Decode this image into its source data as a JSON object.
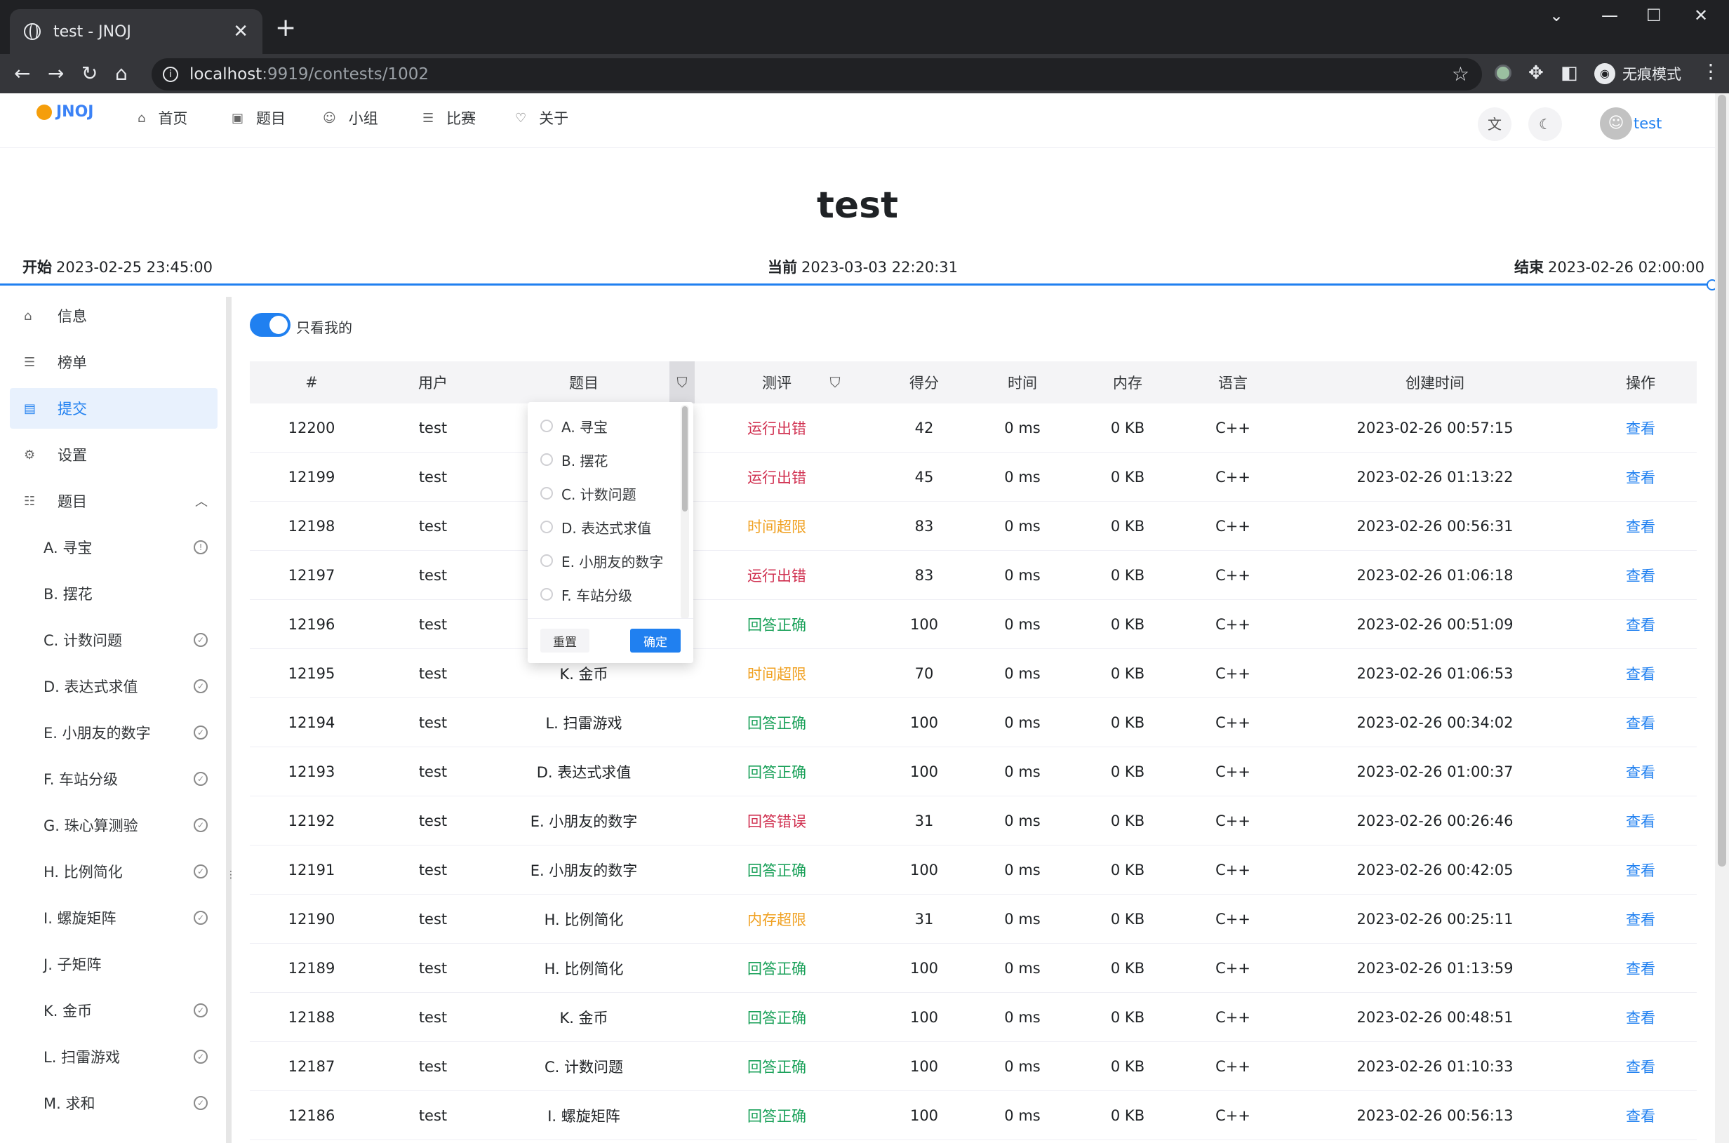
{
  "browser": {
    "tab_title": "test - JNOJ",
    "new_tab": "+",
    "url_host": "localhost",
    "url_rest": ":9919/contests/1002",
    "incognito_label": "无痕模式"
  },
  "nav": {
    "logo": "JNOJ",
    "items": [
      {
        "label": "首页",
        "icon": "home-icon"
      },
      {
        "label": "题目",
        "icon": "problem-icon"
      },
      {
        "label": "小组",
        "icon": "group-icon"
      },
      {
        "label": "比赛",
        "icon": "list-icon"
      },
      {
        "label": "关于",
        "icon": "heart-icon"
      }
    ],
    "user": "test"
  },
  "contest": {
    "title": "test",
    "start_label": "开始",
    "start_time": "2023-02-25 23:45:00",
    "current_label": "当前",
    "current_time": "2023-03-03 22:20:31",
    "end_label": "结束",
    "end_time": "2023-02-26 02:00:00"
  },
  "sidebar": {
    "items": [
      {
        "label": "信息",
        "icon": "home-icon"
      },
      {
        "label": "榜单",
        "icon": "list-icon"
      },
      {
        "label": "提交",
        "icon": "file-icon"
      },
      {
        "label": "设置",
        "icon": "gear-icon"
      },
      {
        "label": "题目",
        "icon": "checklist-icon"
      }
    ],
    "problems": [
      {
        "label": "A. 寻宝",
        "mark": "!"
      },
      {
        "label": "B. 摆花",
        "mark": ""
      },
      {
        "label": "C. 计数问题",
        "mark": "✓"
      },
      {
        "label": "D. 表达式求值",
        "mark": "✓"
      },
      {
        "label": "E. 小朋友的数字",
        "mark": "✓"
      },
      {
        "label": "F. 车站分级",
        "mark": "✓"
      },
      {
        "label": "G. 珠心算测验",
        "mark": "✓"
      },
      {
        "label": "H. 比例简化",
        "mark": "✓"
      },
      {
        "label": "I. 螺旋矩阵",
        "mark": "✓"
      },
      {
        "label": "J. 子矩阵",
        "mark": ""
      },
      {
        "label": "K. 金币",
        "mark": "✓"
      },
      {
        "label": "L. 扫雷游戏",
        "mark": "✓"
      },
      {
        "label": "M. 求和",
        "mark": "✓"
      }
    ]
  },
  "filter_switch": {
    "label": "只看我的",
    "on": true
  },
  "table": {
    "headers": [
      "#",
      "用户",
      "题目",
      "测评",
      "得分",
      "时间",
      "内存",
      "语言",
      "创建时间",
      "操作"
    ],
    "rows": [
      {
        "id": "12200",
        "user": "test",
        "problem": "",
        "status": "运行出错",
        "status_color": "#d03050",
        "score": "42",
        "time": "0 ms",
        "memory": "0 KB",
        "lang": "C++",
        "created": "2023-02-26 00:57:15",
        "action": "查看"
      },
      {
        "id": "12199",
        "user": "test",
        "problem": "",
        "status": "运行出错",
        "status_color": "#d03050",
        "score": "45",
        "time": "0 ms",
        "memory": "0 KB",
        "lang": "C++",
        "created": "2023-02-26 01:13:22",
        "action": "查看"
      },
      {
        "id": "12198",
        "user": "test",
        "problem": "",
        "status": "时间超限",
        "status_color": "#f0a020",
        "score": "83",
        "time": "0 ms",
        "memory": "0 KB",
        "lang": "C++",
        "created": "2023-02-26 00:56:31",
        "action": "查看"
      },
      {
        "id": "12197",
        "user": "test",
        "problem": "",
        "status": "运行出错",
        "status_color": "#d03050",
        "score": "83",
        "time": "0 ms",
        "memory": "0 KB",
        "lang": "C++",
        "created": "2023-02-26 01:06:18",
        "action": "查看"
      },
      {
        "id": "12196",
        "user": "test",
        "problem": "",
        "status": "回答正确",
        "status_color": "#18a058",
        "score": "100",
        "time": "0 ms",
        "memory": "0 KB",
        "lang": "C++",
        "created": "2023-02-26 00:51:09",
        "action": "查看"
      },
      {
        "id": "12195",
        "user": "test",
        "problem": "K. 金币",
        "status": "时间超限",
        "status_color": "#f0a020",
        "score": "70",
        "time": "0 ms",
        "memory": "0 KB",
        "lang": "C++",
        "created": "2023-02-26 01:06:53",
        "action": "查看"
      },
      {
        "id": "12194",
        "user": "test",
        "problem": "L. 扫雷游戏",
        "status": "回答正确",
        "status_color": "#18a058",
        "score": "100",
        "time": "0 ms",
        "memory": "0 KB",
        "lang": "C++",
        "created": "2023-02-26 00:34:02",
        "action": "查看"
      },
      {
        "id": "12193",
        "user": "test",
        "problem": "D. 表达式求值",
        "status": "回答正确",
        "status_color": "#18a058",
        "score": "100",
        "time": "0 ms",
        "memory": "0 KB",
        "lang": "C++",
        "created": "2023-02-26 01:00:37",
        "action": "查看"
      },
      {
        "id": "12192",
        "user": "test",
        "problem": "E. 小朋友的数字",
        "status": "回答错误",
        "status_color": "#d03050",
        "score": "31",
        "time": "0 ms",
        "memory": "0 KB",
        "lang": "C++",
        "created": "2023-02-26 00:26:46",
        "action": "查看"
      },
      {
        "id": "12191",
        "user": "test",
        "problem": "E. 小朋友的数字",
        "status": "回答正确",
        "status_color": "#18a058",
        "score": "100",
        "time": "0 ms",
        "memory": "0 KB",
        "lang": "C++",
        "created": "2023-02-26 00:42:05",
        "action": "查看"
      },
      {
        "id": "12190",
        "user": "test",
        "problem": "H. 比例简化",
        "status": "内存超限",
        "status_color": "#f0a020",
        "score": "31",
        "time": "0 ms",
        "memory": "0 KB",
        "lang": "C++",
        "created": "2023-02-26 00:25:11",
        "action": "查看"
      },
      {
        "id": "12189",
        "user": "test",
        "problem": "H. 比例简化",
        "status": "回答正确",
        "status_color": "#18a058",
        "score": "100",
        "time": "0 ms",
        "memory": "0 KB",
        "lang": "C++",
        "created": "2023-02-26 01:13:59",
        "action": "查看"
      },
      {
        "id": "12188",
        "user": "test",
        "problem": "K. 金币",
        "status": "回答正确",
        "status_color": "#18a058",
        "score": "100",
        "time": "0 ms",
        "memory": "0 KB",
        "lang": "C++",
        "created": "2023-02-26 00:48:51",
        "action": "查看"
      },
      {
        "id": "12187",
        "user": "test",
        "problem": "C. 计数问题",
        "status": "回答正确",
        "status_color": "#18a058",
        "score": "100",
        "time": "0 ms",
        "memory": "0 KB",
        "lang": "C++",
        "created": "2023-02-26 01:10:33",
        "action": "查看"
      },
      {
        "id": "12186",
        "user": "test",
        "problem": "I. 螺旋矩阵",
        "status": "回答正确",
        "status_color": "#18a058",
        "score": "100",
        "time": "0 ms",
        "memory": "0 KB",
        "lang": "C++",
        "created": "2023-02-26 00:56:13",
        "action": "查看"
      }
    ]
  },
  "filter_popover": {
    "options": [
      "A. 寻宝",
      "B. 摆花",
      "C. 计数问题",
      "D. 表达式求值",
      "E. 小朋友的数字",
      "F. 车站分级"
    ],
    "reset_label": "重置",
    "confirm_label": "确定"
  },
  "colors": {
    "accent": "#2080f0",
    "success": "#18a058",
    "error": "#d03050",
    "warning": "#f0a020"
  }
}
